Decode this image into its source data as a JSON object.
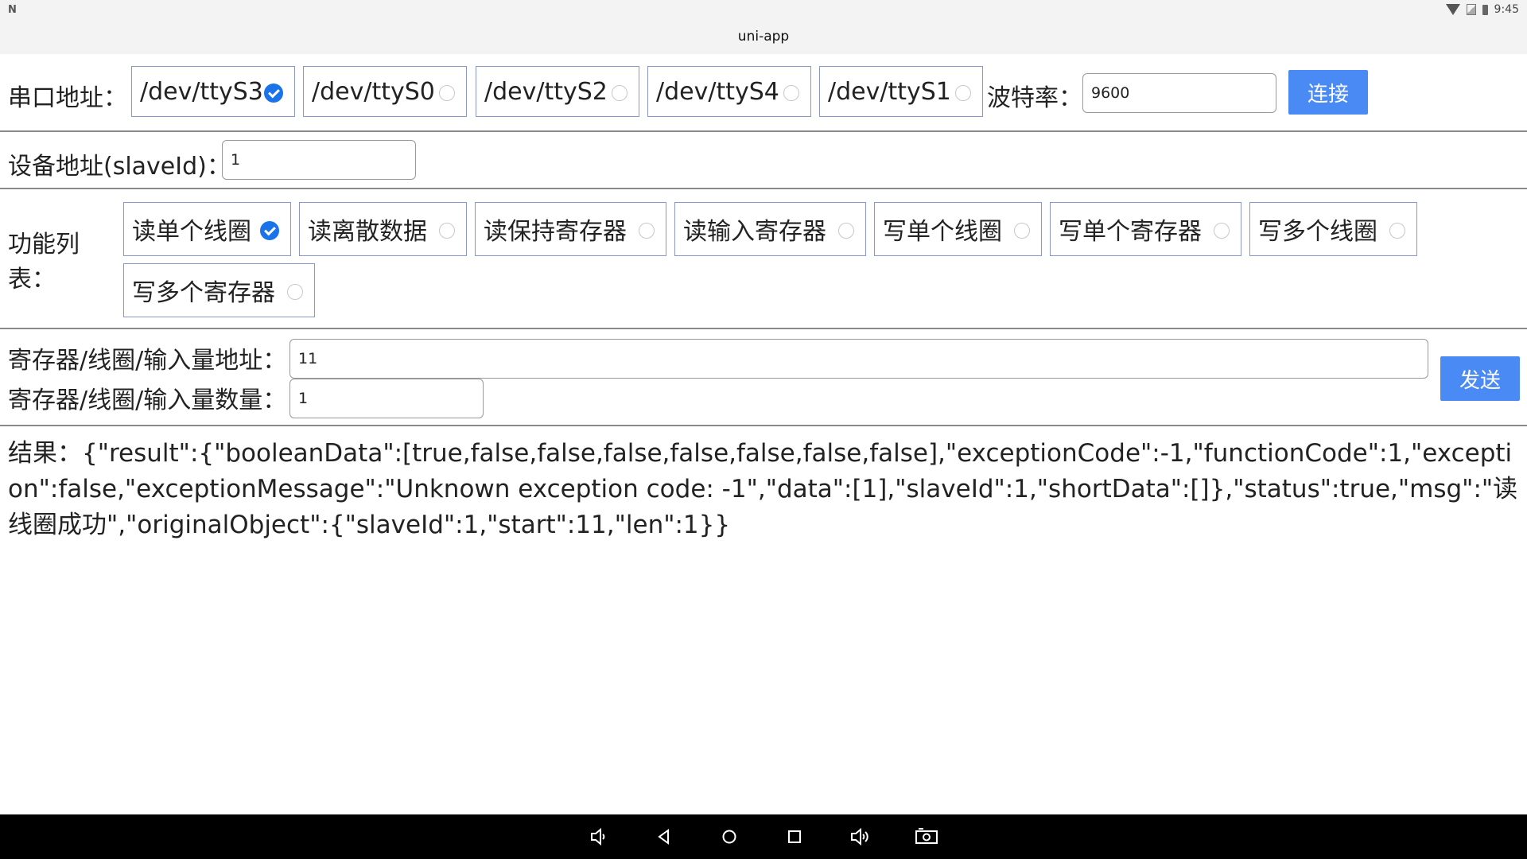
{
  "status_bar": {
    "left_icon": "N",
    "time": "9:45"
  },
  "title_bar": {
    "title": "uni-app"
  },
  "serial": {
    "label": "串口地址：",
    "options": [
      "/dev/ttyS3",
      "/dev/ttyS0",
      "/dev/ttyS2",
      "/dev/ttyS4",
      "/dev/ttyS1"
    ],
    "selected": "/dev/ttyS3",
    "baud_label": "波特率：",
    "baud_value": "9600",
    "connect_label": "连接"
  },
  "device": {
    "label": "设备地址(slaveId)：",
    "value": "1"
  },
  "functions": {
    "label_line1": "功能列",
    "label_line2": "表：",
    "options": [
      "读单个线圈",
      "读离散数据",
      "读保持寄存器",
      "读输入寄存器",
      "写单个线圈",
      "写单个寄存器",
      "写多个线圈",
      "写多个寄存器"
    ],
    "selected": "读单个线圈"
  },
  "register": {
    "address_label": "寄存器/线圈/输入量地址：",
    "address_value": "11",
    "count_label": "寄存器/线圈/输入量数量：",
    "count_value": "1",
    "send_label": "发送"
  },
  "result": {
    "text": "结果：{\"result\":{\"booleanData\":[true,false,false,false,false,false,false,false],\"exceptionCode\":-1,\"functionCode\":1,\"exception\":false,\"exceptionMessage\":\"Unknown exception code: -1\",\"data\":[1],\"slaveId\":1,\"shortData\":[]},\"status\":true,\"msg\":\"读线圈成功\",\"originalObject\":{\"slaveId\":1,\"start\":11,\"len\":1}}"
  },
  "nav_bar": {
    "icons": [
      "volume-down-icon",
      "back-icon",
      "home-icon",
      "recents-icon",
      "volume-up-icon",
      "screenshot-icon"
    ]
  }
}
